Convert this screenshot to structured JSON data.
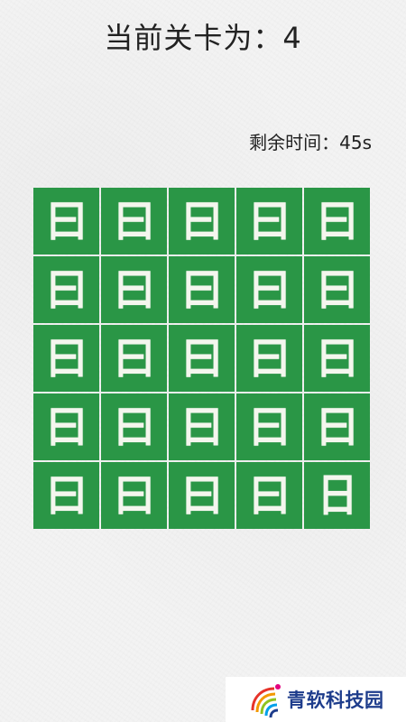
{
  "header": {
    "level_label": "当前关卡为：",
    "level": "4"
  },
  "timer": {
    "text": "剩余时间：45s"
  },
  "board": {
    "rows": 5,
    "cols": 5,
    "cell_color": "#2a9646",
    "cells": [
      "曰",
      "曰",
      "曰",
      "曰",
      "曰",
      "曰",
      "曰",
      "曰",
      "曰",
      "曰",
      "曰",
      "曰",
      "曰",
      "曰",
      "曰",
      "曰",
      "曰",
      "曰",
      "曰",
      "曰",
      "曰",
      "曰",
      "曰",
      "曰",
      "日"
    ]
  },
  "brand": {
    "name": "青软科技园",
    "logo_icon": "qingruan-logo-icon"
  }
}
